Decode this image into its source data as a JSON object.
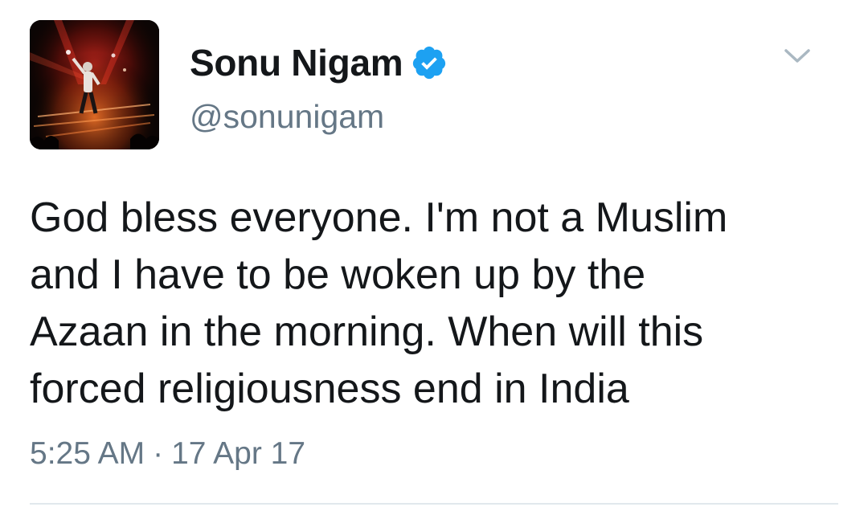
{
  "tweet": {
    "author": {
      "display_name": "Sonu Nigam",
      "handle": "@sonunigam",
      "verified": true,
      "avatar_icon": "concert-stage-photo"
    },
    "text": "God bless everyone. I'm not a Muslim\nand I have to be woken up by the\nAzaan in the morning. When will this\nforced religiousness end in India",
    "time": "5:25 AM",
    "separator": "·",
    "date": "17 Apr 17",
    "menu_icon": "chevron-down-icon"
  },
  "colors": {
    "text_primary": "#14171a",
    "text_secondary": "#657786",
    "verified_blue": "#1da1f2",
    "divider": "#e1e8ed"
  }
}
